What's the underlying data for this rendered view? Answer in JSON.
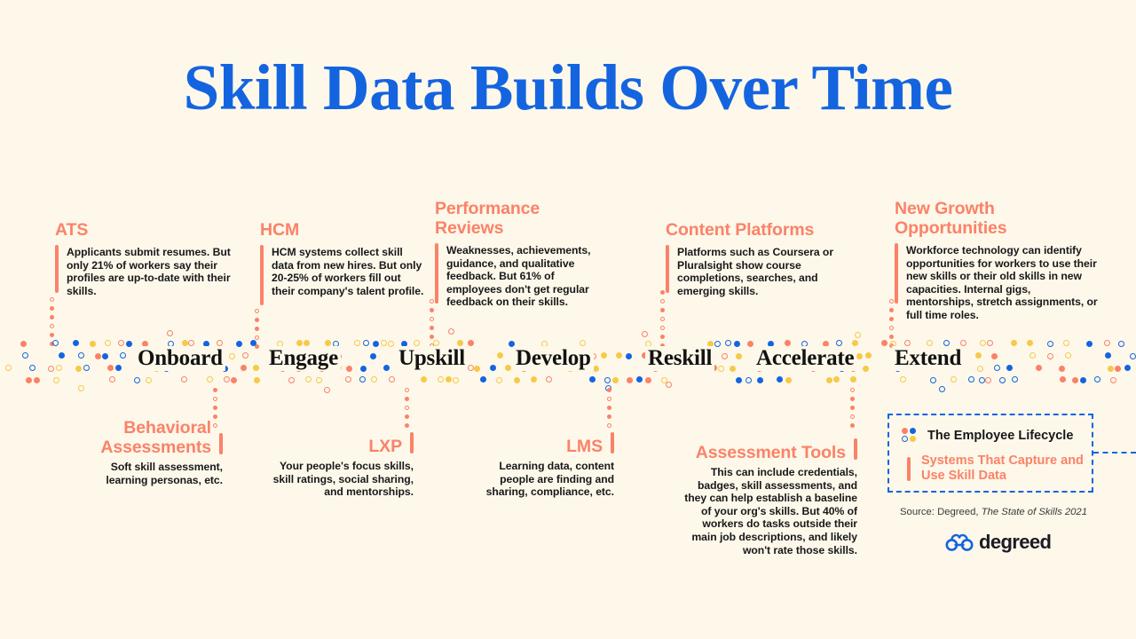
{
  "page": {
    "title": "Skill Data Builds Over Time",
    "background_color": "#fdf8ea",
    "accent_blue": "#1464e0",
    "accent_coral": "#fb8268",
    "accent_yellow": "#f7c948",
    "text_color": "#18181a"
  },
  "timeline": {
    "stages": [
      {
        "label": "Onboard"
      },
      {
        "label": "Engage"
      },
      {
        "label": "Upskill"
      },
      {
        "label": "Develop"
      },
      {
        "label": "Reskill"
      },
      {
        "label": "Accelerate"
      },
      {
        "label": "Extend"
      }
    ]
  },
  "top_blocks": [
    {
      "heading": "ATS",
      "body": "Applicants submit resumes. But only 21% of workers say their profiles are up-to-date with their skills."
    },
    {
      "heading": "HCM",
      "body": "HCM systems collect skill data from new hires. But only 20-25% of workers fill out their company's talent profile."
    },
    {
      "heading": "Performance Reviews",
      "body": "Weaknesses, achievements, guidance, and qualitative feedback. But 61% of employees don't get regular feedback on their skills."
    },
    {
      "heading": "Content Platforms",
      "body": "Platforms such as Coursera or Pluralsight show course completions, searches, and emerging skills."
    },
    {
      "heading": "New Growth Opportunities",
      "body": "Workforce technology can identify opportunities for workers to use their new skills or their old skills in new capacities. Internal gigs, mentorships, stretch assignments, or full time roles."
    }
  ],
  "bottom_blocks": [
    {
      "heading": "Behavioral Assessments",
      "body": "Soft skill assessment, learning personas, etc."
    },
    {
      "heading": "LXP",
      "body": "Your people's focus skills, skill ratings, social sharing, and mentorships."
    },
    {
      "heading": "LMS",
      "body": "Learning data, content people are finding and sharing, compliance, etc."
    },
    {
      "heading": "Assessment Tools",
      "body": "This can include credentials, badges, skill assessments, and they can help establish a baseline of your org's skills. But 40% of workers do tasks outside their main job descriptions, and likely won't rate those skills."
    }
  ],
  "legend": {
    "item_lifecycle": "The Employee Lifecycle",
    "item_systems": "Systems That Capture and Use Skill Data",
    "lifecycle_icon": "four-dot-cluster-icon",
    "systems_icon": "coral-bar-icon"
  },
  "footer": {
    "source_prefix": "Source: Degreed, ",
    "source_title": "The State of Skills 2021",
    "logo_word": "degreed",
    "logo_mark": "binoculars-icon"
  }
}
